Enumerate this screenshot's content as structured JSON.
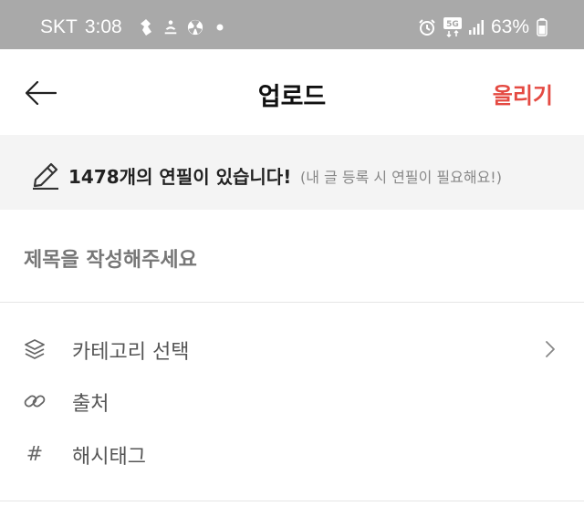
{
  "status_bar": {
    "carrier": "SKT",
    "time": "3:08",
    "left_icons": [
      "app-notification-icon",
      "yoga-icon",
      "radiation-icon",
      "dot-icon"
    ],
    "right_icons": [
      "alarm-icon",
      "5g-icon",
      "signal-icon"
    ],
    "network": "5G",
    "battery": "63%"
  },
  "header": {
    "back_icon": "back-arrow-icon",
    "title": "업로드",
    "upload_label": "올리기",
    "accent_color": "#e44a42"
  },
  "banner": {
    "icon": "pencil-icon",
    "main_text": "1478개의 연필이 있습니다!",
    "sub_text": "(내 글 등록 시 연필이 필요해요!)"
  },
  "form": {
    "title_placeholder": "제목을 작성해주세요",
    "title_value": ""
  },
  "options": [
    {
      "icon": "layers-icon",
      "label": "카테고리 선택",
      "has_chevron": true
    },
    {
      "icon": "link-icon",
      "label": "출처"
    },
    {
      "icon": "hashtag-icon",
      "label": "해시태그"
    }
  ]
}
